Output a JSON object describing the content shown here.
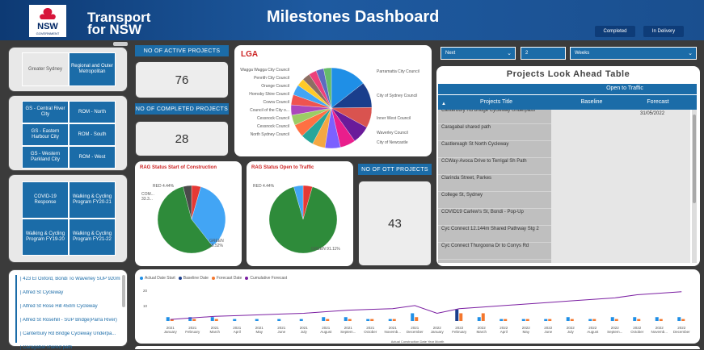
{
  "header": {
    "logo_text": "NSW",
    "logo_subtext": "GOVERNMENT",
    "brand_line1": "Transport",
    "brand_line2": "for NSW",
    "title": "Milestones Dashboard",
    "btn_completed": "Completed",
    "btn_in_delivery": "In Delivery",
    "color": "#1e5aa0"
  },
  "nav": {
    "group1": [
      "Greater Sydney",
      "Regional and Outer Metropolitan"
    ],
    "group2": [
      "GS - Central River City",
      "ROM - North",
      "GS - Eastern Harbour City",
      "ROM - South",
      "GS - Western Parkland City",
      "ROM - West"
    ],
    "group3": [
      "COVID-19 Response",
      "Walking & Cycling Program FY20-21",
      "Walking & Cycling Program FY19-20",
      "Walking & Cycling Program FY21-22"
    ]
  },
  "kpis": {
    "active_title": "NO OF ACTIVE PROJECTS",
    "active_value": "76",
    "completed_title": "NO OF COMPLETED PROJECTS",
    "completed_value": "28",
    "ott_title": "NO OF OTT PROJECTS",
    "ott_value": "43"
  },
  "lga": {
    "title": "LGA",
    "labels_left": [
      "Wagga Wagga City Council",
      "Penrith City Council",
      "Orange Council",
      "Hornsby Shire Council",
      "Cowra Council",
      "Council of the City o...",
      "Cessnock Council",
      "Cessnock Council",
      "North Sydney Council"
    ],
    "labels_right": [
      "Parramatta City Council",
      "City of Sydney Council",
      "Inner West Council",
      "Waverley Council",
      "City of Newcastle"
    ],
    "slices": [
      {
        "value": 14,
        "color": "#1f8fe6"
      },
      {
        "value": 10,
        "color": "#1a3e8c"
      },
      {
        "value": 8,
        "color": "#d9534f"
      },
      {
        "value": 7,
        "color": "#6a1b9a"
      },
      {
        "value": 6,
        "color": "#e91e8c"
      },
      {
        "value": 6,
        "color": "#7b61ff"
      },
      {
        "value": 5,
        "color": "#f4a742"
      },
      {
        "value": 5,
        "color": "#26a69a"
      },
      {
        "value": 5,
        "color": "#ff7043"
      },
      {
        "value": 4,
        "color": "#9ccc65"
      },
      {
        "value": 4,
        "color": "#ab47bc"
      },
      {
        "value": 4,
        "color": "#ef5350"
      },
      {
        "value": 4,
        "color": "#42a5f5"
      },
      {
        "value": 3,
        "color": "#ffca28"
      },
      {
        "value": 3,
        "color": "#8d6e63"
      },
      {
        "value": 3,
        "color": "#ec407a"
      },
      {
        "value": 3,
        "color": "#5c6bc0"
      },
      {
        "value": 3,
        "color": "#66bb6a"
      }
    ]
  },
  "rag_construction": {
    "title": "RAG Status Start of Construction",
    "labels": [
      "RED 4.44%",
      "COM... 33.3...",
      "GREEN 56.52%"
    ],
    "slices": [
      {
        "value": 4.44,
        "color": "#e53935"
      },
      {
        "value": 35,
        "color": "#42a5f5"
      },
      {
        "value": 56.52,
        "color": "#2e8b3a"
      },
      {
        "value": 4.04,
        "color": "#4a4a4a"
      }
    ]
  },
  "rag_traffic": {
    "title": "RAG Status Open to Traffic",
    "labels": [
      "RED 4.44%",
      "GREEN 91.11%"
    ],
    "slices": [
      {
        "value": 4.44,
        "color": "#e53935"
      },
      {
        "value": 91.11,
        "color": "#2e8b3a"
      },
      {
        "value": 4.45,
        "color": "#42a5f5"
      }
    ]
  },
  "filters": {
    "period": "Next",
    "number": "2",
    "unit": "Weeks"
  },
  "lookahead": {
    "title": "Projects Look Ahead Table",
    "group_header": "Open to Traffic",
    "col_title": "Projects Title",
    "col_baseline": "Baseline",
    "col_forecast": "Forecast",
    "first_forecast": "31/05/2022",
    "rows": [
      "Canterbury Rd Bridge Cycleway Underpass",
      "Caragabal shared path",
      "Castlereagh St North Cycleway",
      "CCWay-Avoca Drive to Terrigal Sh Path",
      "Clarinda Street, Parkes",
      "College St, Sydney",
      "COVID19 Carlew's St, Bondi - Pop-Up",
      "Cyc Connect 12.144m Shared Pathway Stg 2",
      "Cyc Connect Thurgoona Dr to Corrys Rd"
    ]
  },
  "project_list": [
    "423 El Oxford, Bondi To Waverley SUP 920mld",
    "Alfred St Cycleway",
    "Alfred St Rose Hill 450m Cycleway",
    "Alfred St Rosehill - SUP Bridge(Parra River)",
    "Canterbury Rd Bridge Cycleway Underpa...",
    "Caragabal shared path"
  ],
  "timeline": {
    "legend": [
      "Actual Date Start",
      "Baseline Date",
      "Forecast Date",
      "Cumulative Forecast"
    ],
    "legend_colors": [
      "#1f8fe6",
      "#1a3e8c",
      "#f4772d",
      "#7b1fa2"
    ],
    "xlabel": "Actual Construction Date Year Month",
    "y_ticks": [
      "20",
      "10"
    ],
    "x_ticks": [
      [
        "2021",
        "January"
      ],
      [
        "2021",
        "February"
      ],
      [
        "2021",
        "March"
      ],
      [
        "2021",
        "April"
      ],
      [
        "2021",
        "May"
      ],
      [
        "2021",
        "June"
      ],
      [
        "2021",
        "July"
      ],
      [
        "2021",
        "August"
      ],
      [
        "2021",
        "Septem..."
      ],
      [
        "2021",
        "October"
      ],
      [
        "2021",
        "Novemb..."
      ],
      [
        "2021",
        "December"
      ],
      [
        "2022",
        "January"
      ],
      [
        "2022",
        "February"
      ],
      [
        "2022",
        "March"
      ],
      [
        "2022",
        "April"
      ],
      [
        "2022",
        "May"
      ],
      [
        "2022",
        "June"
      ],
      [
        "2022",
        "July"
      ],
      [
        "2022",
        "August"
      ],
      [
        "2022",
        "Septem..."
      ],
      [
        "2022",
        "October"
      ],
      [
        "2022",
        "Novemb..."
      ],
      [
        "2022",
        "December"
      ]
    ],
    "cumulative": [
      1,
      2,
      3,
      3.5,
      4,
      4.5,
      5,
      6,
      7,
      7.5,
      8,
      10,
      5,
      8,
      9,
      10,
      11,
      12,
      13,
      14,
      15,
      17,
      18,
      19
    ],
    "bars_actual": [
      1,
      1,
      1,
      0.5,
      0.5,
      0.5,
      0.5,
      1,
      1,
      0.5,
      0.5,
      2,
      0,
      3,
      1,
      0.5,
      0.5,
      0.5,
      1,
      0.5,
      1,
      1,
      1,
      1
    ],
    "bars_forecast": [
      0.5,
      0.5,
      0.5,
      0,
      0,
      0,
      0,
      0.5,
      0.5,
      0.5,
      0.5,
      1,
      0,
      2,
      2,
      0.5,
      0.5,
      0.5,
      0.5,
      0.5,
      0.5,
      0.5,
      0.5,
      0.5
    ]
  }
}
